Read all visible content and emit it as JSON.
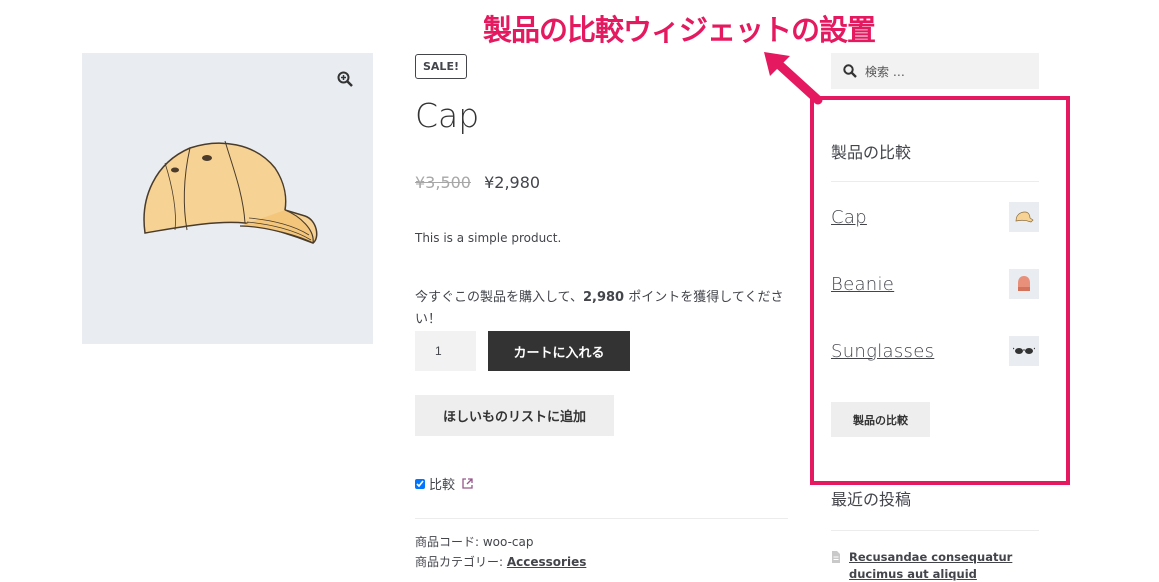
{
  "annotation": {
    "title": "製品の比較ウィジェットの設置",
    "color": "#e5195f"
  },
  "product": {
    "sale_badge": "SALE!",
    "title": "Cap",
    "old_price": "¥3,500",
    "price": "¥2,980",
    "short_description": "This is a simple product.",
    "points_message_before": "今すぐこの製品を購入して、",
    "points_value": "2,980",
    "points_message_after": " ポイントを獲得してください！",
    "quantity": "1",
    "add_to_cart_label": "カートに入れる",
    "wishlist_label": "ほしいものリストに追加",
    "compare_label": "比較",
    "compare_checked": true,
    "sku_label": "商品コード: ",
    "sku": "woo-cap",
    "category_label": "商品カテゴリー: ",
    "category": "Accessories"
  },
  "sidebar": {
    "search_placeholder": "検索 …",
    "compare_widget": {
      "title": "製品の比較",
      "items": [
        {
          "name": "Cap",
          "icon": "cap-thumb-icon"
        },
        {
          "name": "Beanie",
          "icon": "beanie-thumb-icon"
        },
        {
          "name": "Sunglasses",
          "icon": "sunglasses-thumb-icon"
        }
      ],
      "button_label": "製品の比較"
    },
    "recent_posts": {
      "title": "最近の投稿",
      "items": [
        {
          "title": "Recusandae consequatur ducimus aut aliquid"
        }
      ]
    }
  },
  "colors": {
    "accent": "#e5195f",
    "button_dark": "#333333",
    "image_bg": "#e9edf1"
  }
}
